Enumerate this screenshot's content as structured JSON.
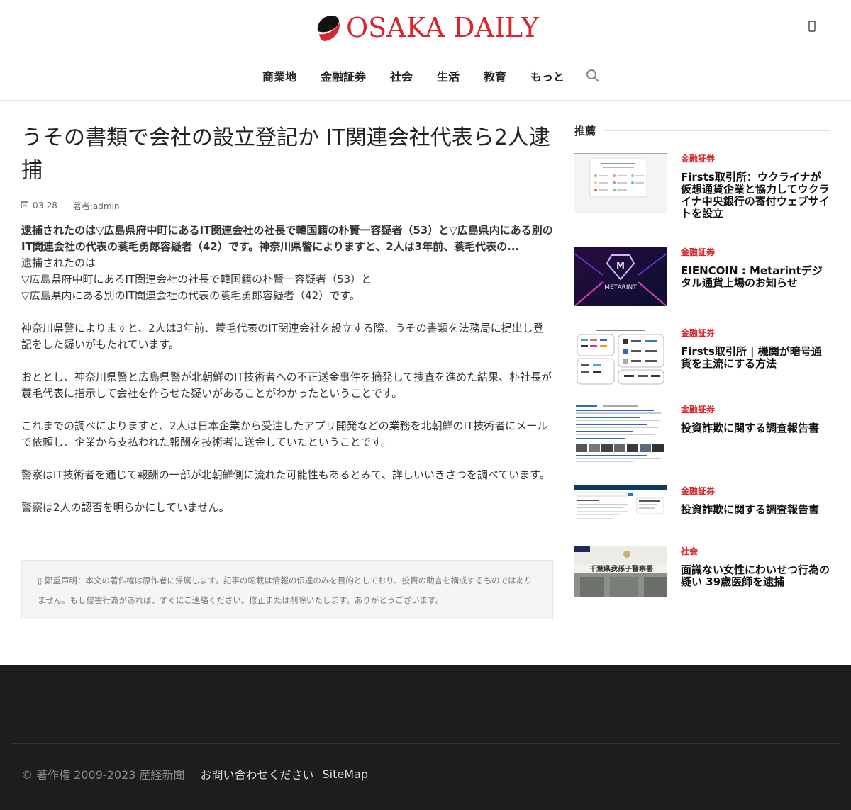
{
  "header": {
    "logo_text": "OSAKA DAILY",
    "account_icon": "user-icon"
  },
  "nav": {
    "items": [
      "商業地",
      "金融証券",
      "社会",
      "生活",
      "教育",
      "もっと"
    ],
    "search_icon": "search-icon"
  },
  "article": {
    "title": "うその書類で会社の設立登記か IT関連会社代表ら2人逮捕",
    "date": "03-28",
    "author": "著者:admin",
    "lead": "逮捕されたのは▽広島県府中町にあるIT関連会社の社長で韓国籍の朴賢一容疑者（53）と▽広島県内にある別のIT関連会社の代表の蓑毛勇郎容疑者（42）です。神奈川県警によりますと、2人は3年前、蓑毛代表の...",
    "body": [
      "逮捕されたのは",
      "▽広島県府中町にあるIT関連会社の社長で韓国籍の朴賢一容疑者（53）と",
      "▽広島県内にある別のIT関連会社の代表の蓑毛勇郎容疑者（42）です。",
      "神奈川県警によりますと、2人は3年前、蓑毛代表のIT関連会社を設立する際、うその書類を法務局に提出し登記をした疑いがもたれています。",
      "おととし、神奈川県警と広島県警が北朝鮮のIT技術者への不正送金事件を摘発して捜査を進めた結果、朴社長が蓑毛代表に指示して会社を作らせた疑いがあることがわかったということです。",
      "これまでの調べによりますと、2人は日本企業から受注したアプリ開発などの業務を北朝鮮のIT技術者にメールで依頼し、企業から支払われた報酬を技術者に送金していたということです。",
      "警察はIT技術者を通じて報酬の一部が北朝鮮側に流れた可能性もあるとみて、詳しいいきさつを調べています。",
      "警察は2人の認否を明らかにしていません。"
    ],
    "notice": "鄭重声明：本文の著作権は原作者に帰属します。記事の転載は情報の伝達のみを目的としており、投資の助言を構成するものではありません。もし侵害行為があれば、すぐにご連絡ください。修正または削除いたします。ありがとうございます。"
  },
  "sidebar": {
    "heading": "推薦",
    "items": [
      {
        "category": "金融証券",
        "title": "Firsts取引所：ウクライナが仮想通貨企業と協力してウクライナ中央銀行の寄付ウェブサイトを設立"
      },
      {
        "category": "金融証券",
        "title": "EIENCOIN : Metarintデジタル通貨上場のお知らせ",
        "thumb_text": "METARINT"
      },
      {
        "category": "金融証券",
        "title": "Firsts取引所 | 機関が暗号通貨を主流にする方法"
      },
      {
        "category": "金融証券",
        "title": "投資詐欺に関する調査報告書"
      },
      {
        "category": "金融証券",
        "title": "投資詐欺に関する調査報告書"
      },
      {
        "category": "社会",
        "title": "面識ない女性にわいせつ行為の疑い 39歳医師を逮捕",
        "thumb_text": "千葉県我孫子警察署"
      }
    ]
  },
  "footer": {
    "copyright": "© 著作権 2009-2023 産経新聞",
    "links": [
      "お問い合わせください",
      "SiteMap"
    ]
  },
  "colors": {
    "brand_red": "#d8262f",
    "footer_bg": "#1c1d1f"
  }
}
